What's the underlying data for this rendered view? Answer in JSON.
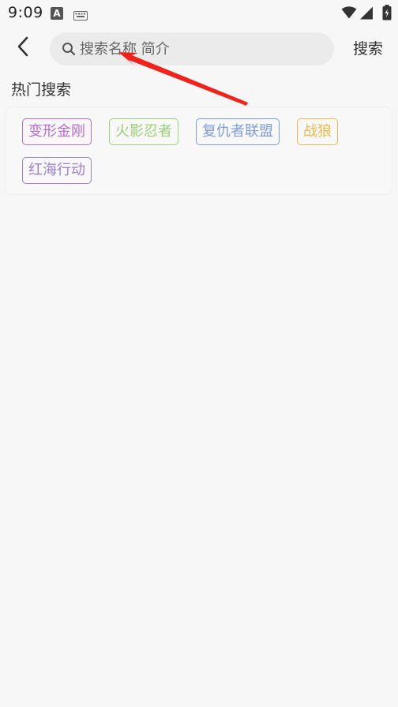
{
  "status_bar": {
    "time": "9:09",
    "a_icon_letter": "A",
    "icons": [
      "a-notification-icon",
      "keyboard-icon",
      "wifi-icon",
      "signal-icon",
      "battery-icon"
    ]
  },
  "header": {
    "back_icon": "chevron-left-icon",
    "search_placeholder": "搜索名称 简介",
    "search_value": "",
    "search_button_label": "搜索"
  },
  "hot_search": {
    "title": "热门搜索",
    "tags": [
      {
        "label": "变形金刚",
        "color": "#b86bd0"
      },
      {
        "label": "火影忍者",
        "color": "#9ccf76"
      },
      {
        "label": "复仇者联盟",
        "color": "#7f9be0"
      },
      {
        "label": "战狼",
        "color": "#f0b84c"
      },
      {
        "label": "红海行动",
        "color": "#9d7fd4"
      }
    ]
  },
  "annotation": {
    "type": "red-arrow",
    "color": "#f0221b",
    "points_to": "search-input"
  }
}
